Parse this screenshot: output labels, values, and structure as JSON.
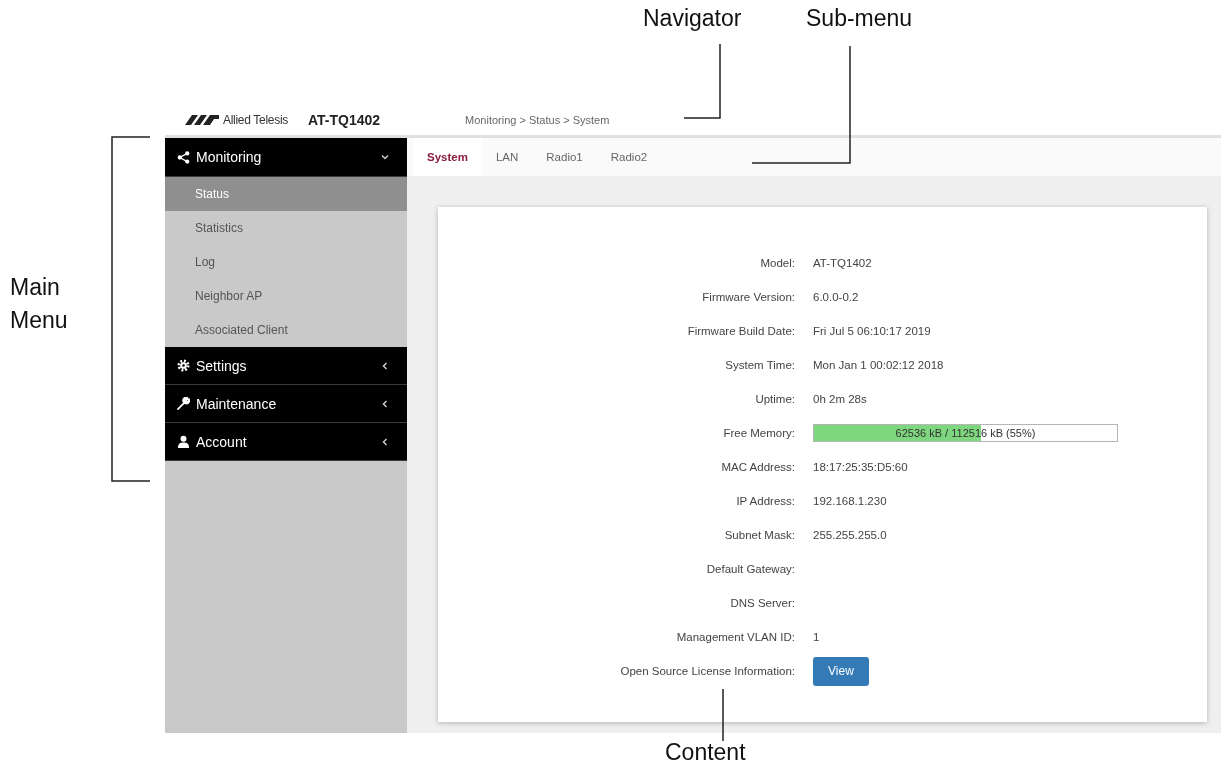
{
  "callouts": [
    {
      "label": "Navigator"
    },
    {
      "label": "Sub-menu"
    },
    {
      "label": "Main Menu"
    },
    {
      "label": "Content"
    }
  ],
  "header": {
    "brand": "Allied Telesis",
    "model": "AT-TQ1402",
    "breadcrumb": "Monitoring > Status > System"
  },
  "sidebar": {
    "menus": [
      {
        "label": "Monitoring",
        "expanded": true,
        "children": [
          {
            "label": "Status",
            "selected": true
          },
          {
            "label": "Statistics",
            "selected": false
          },
          {
            "label": "Log",
            "selected": false
          },
          {
            "label": "Neighbor AP",
            "selected": false
          },
          {
            "label": "Associated Client",
            "selected": false
          }
        ]
      },
      {
        "label": "Settings",
        "expanded": false
      },
      {
        "label": "Maintenance",
        "expanded": false
      },
      {
        "label": "Account",
        "expanded": false
      }
    ]
  },
  "tabs": [
    {
      "label": "System",
      "selected": true
    },
    {
      "label": "LAN",
      "selected": false
    },
    {
      "label": "Radio1",
      "selected": false
    },
    {
      "label": "Radio2",
      "selected": false
    }
  ],
  "content": {
    "rows": [
      {
        "kind": "text",
        "label": "Model:",
        "value": "AT-TQ1402"
      },
      {
        "kind": "text",
        "label": "Firmware Version:",
        "value": "6.0.0-0.2"
      },
      {
        "kind": "text",
        "label": "Firmware Build Date:",
        "value": "Fri Jul 5 06:10:17 2019"
      },
      {
        "kind": "text",
        "label": "System Time:",
        "value": "Mon Jan 1 00:02:12 2018"
      },
      {
        "kind": "text",
        "label": "Uptime:",
        "value": "0h 2m 28s"
      },
      {
        "kind": "meter",
        "label": "Free Memory:",
        "level": 0.55,
        "reading": "62536 kB / 112516 kB (55%)"
      },
      {
        "kind": "text",
        "label": "MAC Address:",
        "value": "18:17:25:35:D5:60"
      },
      {
        "kind": "text",
        "label": "IP Address:",
        "value": "192.168.1.230"
      },
      {
        "kind": "text",
        "label": "Subnet Mask:",
        "value": "255.255.255.0"
      },
      {
        "kind": "text",
        "label": "Default Gateway:"
      },
      {
        "kind": "text",
        "label": "DNS Server:"
      },
      {
        "kind": "text",
        "label": "Management VLAN ID:",
        "value": "1"
      },
      {
        "kind": "button",
        "label": "Open Source License Information:",
        "button": "View"
      }
    ]
  }
}
